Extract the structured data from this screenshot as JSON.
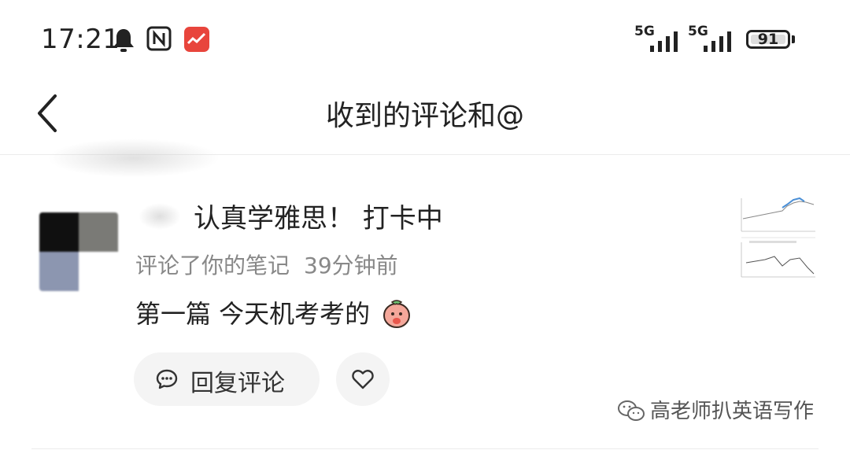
{
  "status_bar": {
    "time": "17:21",
    "signal_1_label": "5G",
    "signal_2_label": "5G",
    "battery": "91",
    "icons": [
      "bell-icon",
      "nfc-icon",
      "app-notification-icon",
      "signal-icon",
      "battery-icon"
    ]
  },
  "navbar": {
    "title": "收到的评论和@",
    "back_icon": "chevron-left-icon"
  },
  "comment": {
    "user_name": "认真学雅思！ 打卡中",
    "action": "评论了你的笔记",
    "time_ago": "39分钟前",
    "text": "第一篇 今天机考考的",
    "reply_label": "回复评论",
    "reply_icon": "chat-bubble-icon",
    "like_icon": "heart-icon",
    "thumbnail": "note-thumbnail-chart"
  },
  "watermark": {
    "text": "高老师扒英语写作",
    "icon": "wechat-icon"
  },
  "colors": {
    "text_primary": "#222222",
    "text_secondary": "#888888",
    "button_bg": "#f4f4f4",
    "divider": "#ececec"
  }
}
